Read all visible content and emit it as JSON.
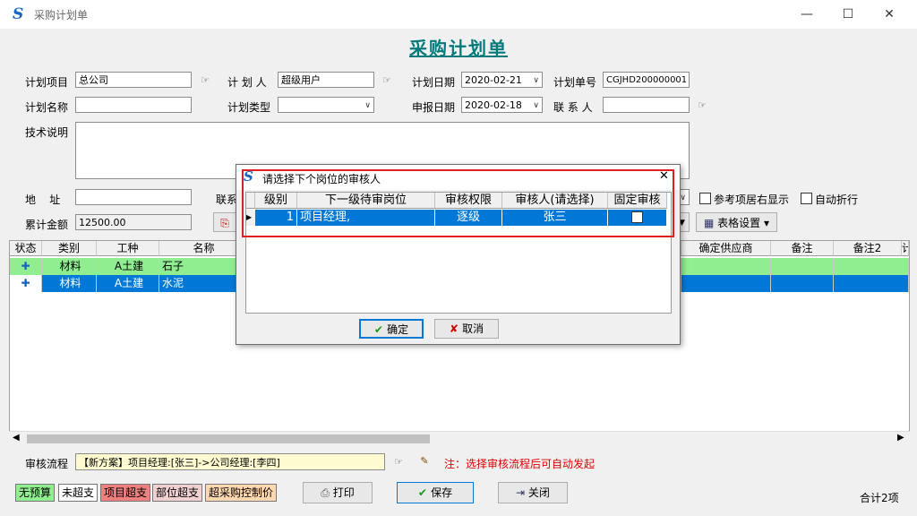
{
  "window": {
    "title": "采购计划单",
    "minimize": "—",
    "maximize": "☐",
    "close": "✕"
  },
  "page_title": "采购计划单",
  "form": {
    "plan_project_label": "计划项目",
    "plan_project_value": "总公司",
    "planner_label": "计 划 人",
    "planner_value": "超级用户",
    "plan_date_label": "计划日期",
    "plan_date_value": "2020-02-21",
    "plan_no_label": "计划单号",
    "plan_no_value": "CGJHD200000001",
    "plan_name_label": "计划名称",
    "plan_name_value": "",
    "plan_type_label": "计划类型",
    "plan_type_value": "",
    "report_date_label": "申报日期",
    "report_date_value": "2020-02-18",
    "contact_label": "联 系 人",
    "contact_value": "",
    "tech_label": "技术说明",
    "tech_value": "",
    "address_label": "地    址",
    "address_value": "",
    "contact2_label": "联系",
    "total_label": "累计金额",
    "total_value": "12500.00",
    "ref_right_label": "参考项居右显示",
    "auto_wrap_label": "自动折行",
    "table_settings_label": "表格设置"
  },
  "grid": {
    "headers": [
      "状态",
      "类别",
      "工种",
      "名称",
      "确定供应商",
      "备注",
      "备注2",
      "计"
    ],
    "rows": [
      {
        "category": "材料",
        "trade": "A土建",
        "name": "石子"
      },
      {
        "category": "材料",
        "trade": "A土建",
        "name": "水泥"
      }
    ]
  },
  "footer": {
    "flow_label": "审核流程",
    "flow_value": "【新方案】项目经理:[张三]->公司经理:[李四]",
    "flow_note": "注：选择审核流程后可自动发起",
    "tags": [
      "无预算",
      "未超支",
      "项目超支",
      "部位超支",
      "超采购控制价"
    ],
    "print_label": "打印",
    "save_label": "保存",
    "close_label": "关闭",
    "total_count": "合计2项"
  },
  "dialog": {
    "title": "请选择下个岗位的审核人",
    "headers": [
      "级别",
      "下一级待审岗位",
      "审核权限",
      "审核人(请选择)",
      "固定审核"
    ],
    "row": {
      "level": "1",
      "post": "项目经理,",
      "permission": "逐级",
      "reviewer": "张三",
      "fixed": false
    },
    "ok_label": "确定",
    "cancel_label": "取消"
  },
  "colors": {
    "title_teal": "#007a7a",
    "selection_blue": "#0078d7",
    "row_green": "#90ee90",
    "highlight_red": "#e02020",
    "note_red": "#e00000"
  }
}
